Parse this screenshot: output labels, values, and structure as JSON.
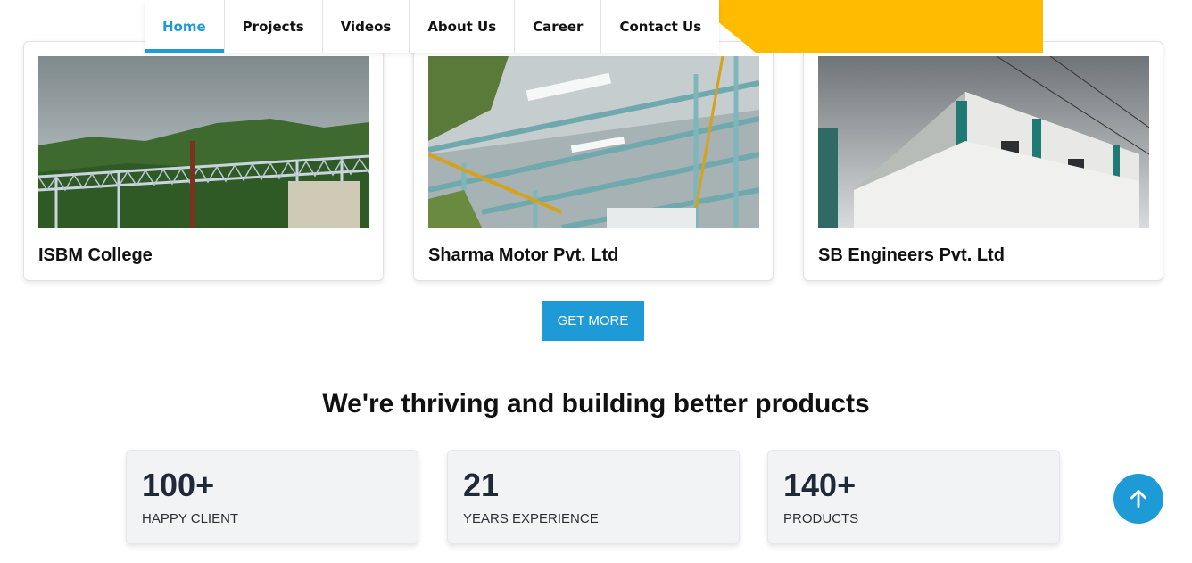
{
  "nav": {
    "items": [
      {
        "label": "Home",
        "active": true
      },
      {
        "label": "Projects"
      },
      {
        "label": "Videos"
      },
      {
        "label": "About Us"
      },
      {
        "label": "Career"
      },
      {
        "label": "Contact Us"
      }
    ]
  },
  "projects": [
    {
      "title": "ISBM College"
    },
    {
      "title": "Sharma Motor Pvt. Ltd"
    },
    {
      "title": "SB Engineers Pvt. Ltd"
    }
  ],
  "cta": {
    "label": "GET MORE"
  },
  "headline": "We're thriving and building better products",
  "stats": [
    {
      "value": "100+",
      "label": "HAPPY CLIENT"
    },
    {
      "value": "21",
      "label": "YEARS EXPERIENCE"
    },
    {
      "value": "140+",
      "label": "PRODUCTS"
    }
  ],
  "icons": {
    "scroll_top": "arrow-up-icon"
  },
  "colors": {
    "accent": "#1e9bd7",
    "yellow": "#ffbb00"
  }
}
